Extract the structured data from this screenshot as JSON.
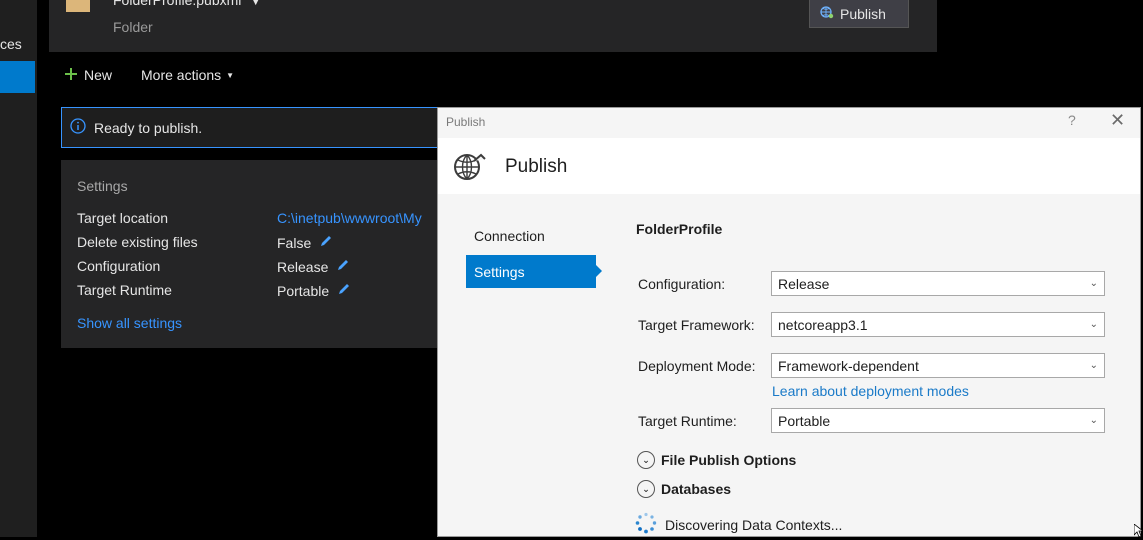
{
  "left_strip": {
    "fragment_text": "ces"
  },
  "profile": {
    "file_name": "FolderProfile.pubxml",
    "type": "Folder",
    "publish_button": "Publish"
  },
  "actions": {
    "new_label": "New",
    "more_label": "More actions"
  },
  "info": {
    "text": "Ready to publish."
  },
  "settings": {
    "heading": "Settings",
    "rows": [
      {
        "label": "Target location",
        "value": "C:\\inetpub\\wwwroot\\My"
      },
      {
        "label": "Delete existing files",
        "value": "False"
      },
      {
        "label": "Configuration",
        "value": "Release"
      },
      {
        "label": "Target Runtime",
        "value": "Portable"
      }
    ],
    "show_all": "Show all settings"
  },
  "dialog": {
    "title": "Publish",
    "help": "?",
    "heading": "Publish",
    "nav": [
      "Connection",
      "Settings"
    ],
    "profile_name": "FolderProfile",
    "fields": {
      "configuration": {
        "label": "Configuration:",
        "value": "Release"
      },
      "framework": {
        "label": "Target Framework:",
        "value": "netcoreapp3.1"
      },
      "deployment": {
        "label": "Deployment Mode:",
        "value": "Framework-dependent"
      },
      "runtime": {
        "label": "Target Runtime:",
        "value": "Portable"
      }
    },
    "learn_link": "Learn about deployment modes",
    "file_publish_options": "File Publish Options",
    "databases": "Databases",
    "discovering": "Discovering Data Contexts..."
  },
  "colors": {
    "accent": "#007acc",
    "link_dark": "#3794ff",
    "link_light": "#1a7ac8",
    "folder": "#dcb67a",
    "plus": "#6cc04a"
  }
}
